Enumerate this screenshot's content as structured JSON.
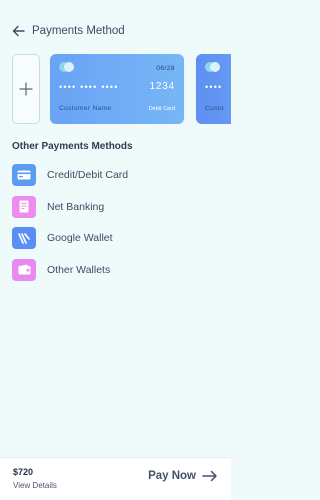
{
  "header": {
    "title": "Payments Method"
  },
  "cards": [
    {
      "expiry": "06/28",
      "masked_digits": "•••• •••• ••••",
      "last_digits": "1234",
      "holder": "Customer Name",
      "type": "Debit Card"
    },
    {
      "masked_digits": "••••",
      "holder": "Custo"
    }
  ],
  "section": {
    "title": "Other Payments Methods"
  },
  "methods": [
    {
      "label": "Credit/Debit Card",
      "icon": "card-icon",
      "color": "#5b9bf2"
    },
    {
      "label": "Net Banking",
      "icon": "bank-document-icon",
      "color": "#ee8bef"
    },
    {
      "label": "Google Wallet",
      "icon": "wallet-logo-icon",
      "color": "#5b8ef2"
    },
    {
      "label": "Other Wallets",
      "icon": "wallet-icon",
      "color": "#e88af0"
    }
  ],
  "footer": {
    "amount": "$720",
    "details_label": "View Details",
    "pay_label": "Pay Now"
  }
}
